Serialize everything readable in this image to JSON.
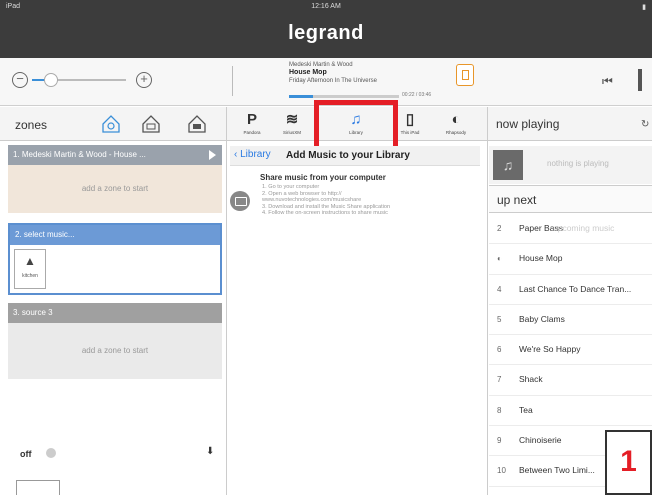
{
  "status": {
    "device": "iPad",
    "time": "12:16 AM",
    "battery": "▮"
  },
  "app": {
    "brand": "legrand"
  },
  "transport": {
    "vol_minus": "−",
    "vol_plus": "+",
    "volume": 0.2,
    "artist": "Medeski Martin & Wood",
    "title": "House Mop",
    "album": "Friday Afternoon In The Universe",
    "time": "00:22 / 03:46",
    "progress": 0.22,
    "prev": "⏮"
  },
  "zones": {
    "header": "zones",
    "items": [
      {
        "name": "1. Medeski Martin & Wood - House ...",
        "hint": "add a zone to start"
      },
      {
        "name": "2. select music...",
        "room": "kitchen"
      },
      {
        "name": "3. source 3",
        "hint": "add a zone to start"
      }
    ],
    "off": "off"
  },
  "sources": [
    {
      "glyph": "P",
      "label": "Pandora"
    },
    {
      "glyph": "≋",
      "label": "SiriusXM"
    },
    {
      "glyph": "♫",
      "label": "Library"
    },
    {
      "glyph": "▯",
      "label": "This iPad"
    },
    {
      "glyph": "◐",
      "label": "Rhapsody"
    }
  ],
  "library": {
    "back": "Library",
    "title": "Add Music to your Library",
    "heading": "Share music from your computer",
    "steps": [
      "1. Go to your computer",
      "2. Open a web browser to http://",
      "www.nuvotechnologies.com/musicshare",
      "3. Download and install the Music Share application",
      "4. Follow the on-screen instructions to share music"
    ]
  },
  "now_playing": {
    "header": "now playing",
    "empty": "nothing is playing"
  },
  "up_next": {
    "header": "up next",
    "coming": "upcoming music",
    "items": [
      {
        "n": "2",
        "title": "Paper Bass"
      },
      {
        "n": "◐",
        "title": "House Mop"
      },
      {
        "n": "4",
        "title": "Last Chance To Dance Tran..."
      },
      {
        "n": "5",
        "title": "Baby Clams"
      },
      {
        "n": "6",
        "title": "We're So Happy"
      },
      {
        "n": "7",
        "title": "Shack"
      },
      {
        "n": "8",
        "title": "Tea"
      },
      {
        "n": "9",
        "title": "Chinoiserie"
      },
      {
        "n": "10",
        "title": "Between Two Limi..."
      }
    ]
  },
  "callout": "1",
  "colors": {
    "accent": "#3a8fd8",
    "highlight": "#e41e26",
    "zone_selected": "#6c9ad6"
  }
}
